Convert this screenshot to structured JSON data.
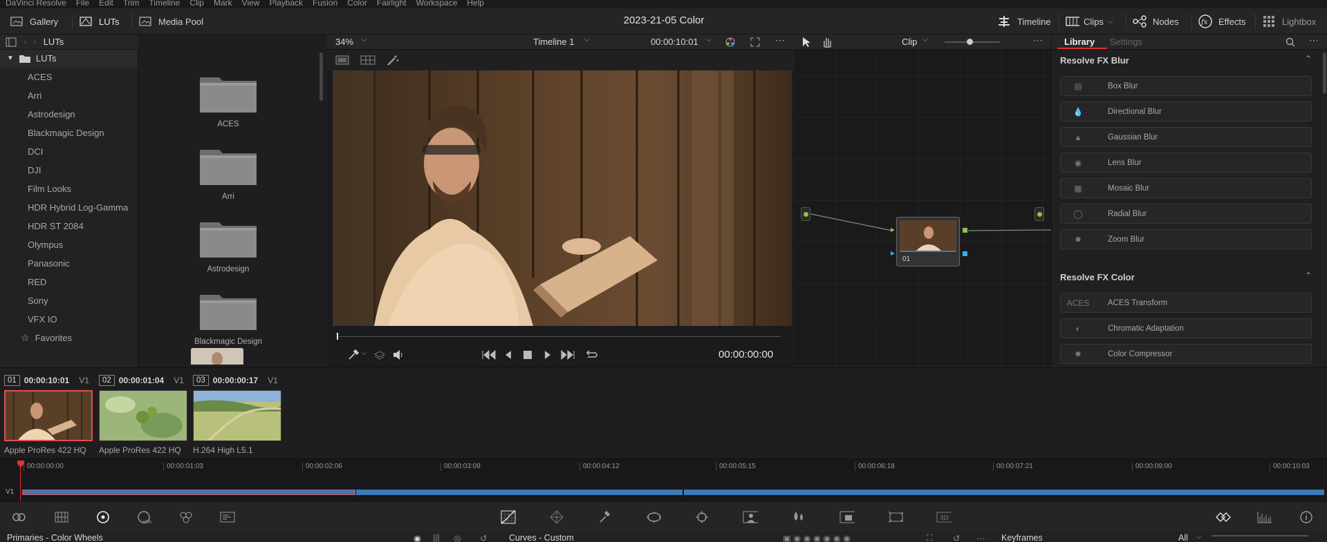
{
  "menu": [
    "DaVinci Resolve",
    "File",
    "Edit",
    "Trim",
    "Timeline",
    "Clip",
    "Mark",
    "View",
    "Playback",
    "Fusion",
    "Color",
    "Fairlight",
    "Workspace",
    "Help"
  ],
  "toolbar": {
    "gallery": "Gallery",
    "luts": "LUTs",
    "media_pool": "Media Pool",
    "project_title": "2023-21-05 Color",
    "timeline": "Timeline",
    "clips": "Clips",
    "nodes": "Nodes",
    "effects": "Effects",
    "lightbox": "Lightbox"
  },
  "lut_panel": {
    "title": "LUTs",
    "root": "LUTs",
    "items": [
      "ACES",
      "Arri",
      "Astrodesign",
      "Blackmagic Design",
      "DCI",
      "DJI",
      "Film Looks",
      "HDR Hybrid Log-Gamma",
      "HDR ST 2084",
      "Olympus",
      "Panasonic",
      "RED",
      "Sony",
      "VFX IO"
    ],
    "favorites": "Favorites",
    "folders": [
      "ACES",
      "Arri",
      "Astrodesign",
      "Blackmagic Design"
    ]
  },
  "viewer": {
    "zoom": "34%",
    "timeline_name": "Timeline 1",
    "timecode": "00:00:10:01",
    "playhead_tc": "00:00:00:00"
  },
  "node_editor": {
    "mode": "Clip",
    "node_label": "01"
  },
  "fx_library": {
    "tab_library": "Library",
    "tab_settings": "Settings",
    "categories": [
      {
        "name": "Resolve FX Blur",
        "items": [
          "Box Blur",
          "Directional Blur",
          "Gaussian Blur",
          "Lens Blur",
          "Mosaic Blur",
          "Radial Blur",
          "Zoom Blur"
        ]
      },
      {
        "name": "Resolve FX Color",
        "items": [
          "ACES Transform",
          "Chromatic Adaptation",
          "Color Compressor"
        ]
      }
    ]
  },
  "clips": [
    {
      "num": "01",
      "tc": "00:00:10:01",
      "track": "V1",
      "codec": "Apple ProRes 422 HQ"
    },
    {
      "num": "02",
      "tc": "00:00:01:04",
      "track": "V1",
      "codec": "Apple ProRes 422 HQ"
    },
    {
      "num": "03",
      "tc": "00:00:00:17",
      "track": "V1",
      "codec": "H.264 High L5.1"
    }
  ],
  "mini_timeline": {
    "track": "V1",
    "ticks": [
      "00:00:00:00",
      "00:00:01:03",
      "00:00:02:06",
      "00:00:03:09",
      "00:00:04:12",
      "00:00:05:15",
      "00:00:06:18",
      "00:00:07:21",
      "00:00:09:00",
      "00:00:10:03"
    ]
  },
  "bottom": {
    "primaries": "Primaries - Color Wheels",
    "curves": "Curves - Custom",
    "keyframes": "Keyframes",
    "all": "All"
  },
  "colors": {
    "accent_red": "#e03030",
    "clip_blue": "#3b7bb5",
    "node_green": "#8bc34a"
  }
}
